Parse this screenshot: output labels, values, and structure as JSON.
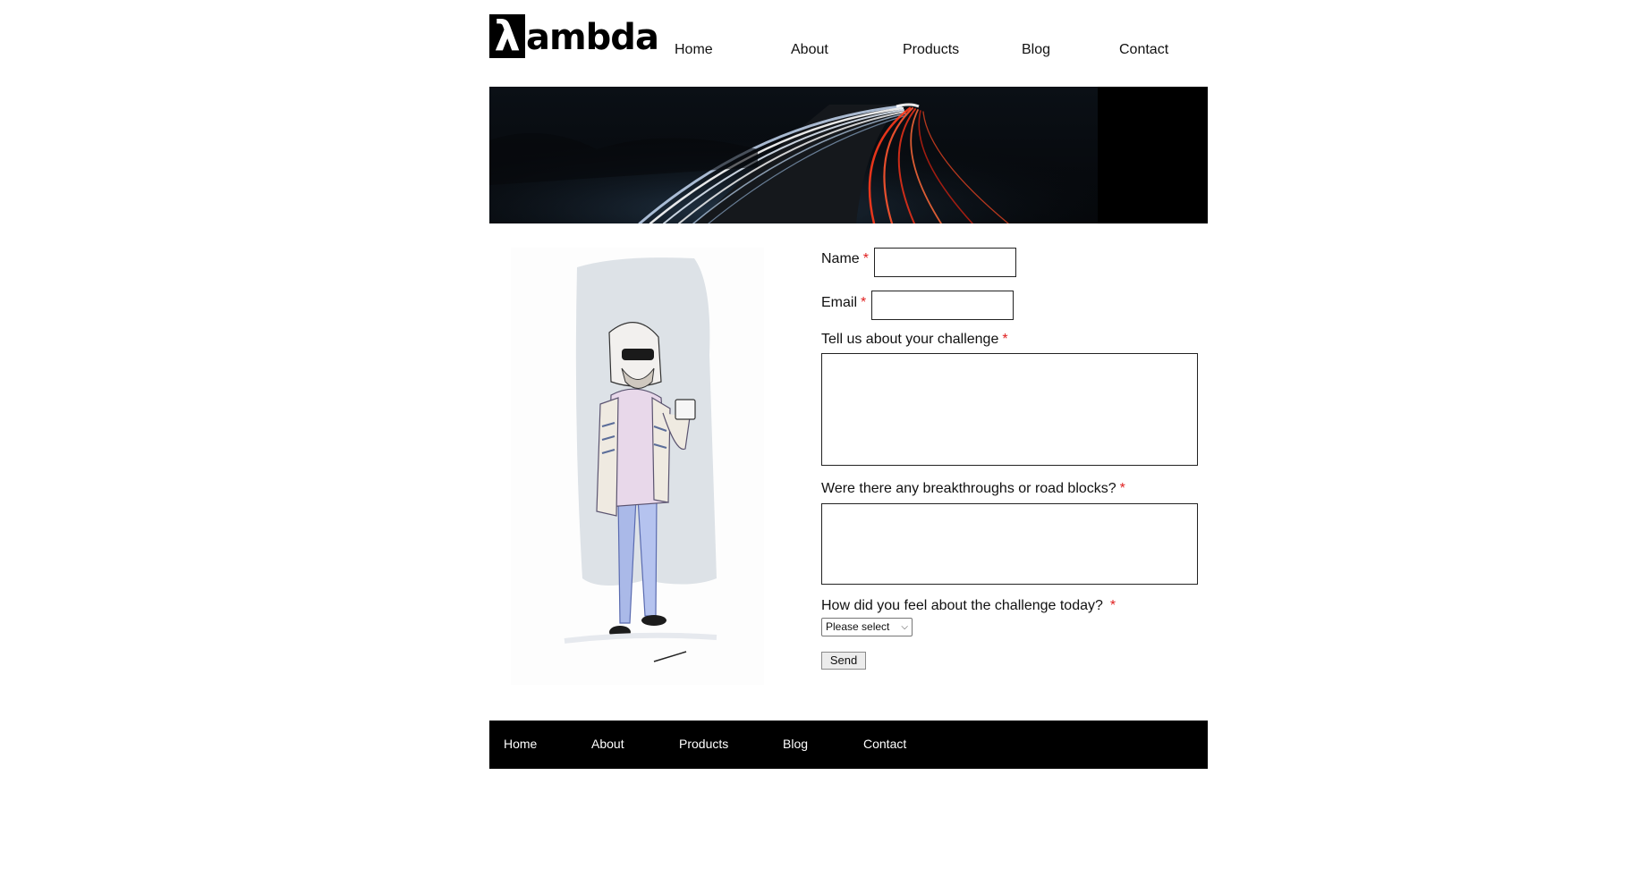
{
  "brand": {
    "logo_mark": "λ",
    "logo_text": "ambda"
  },
  "nav": {
    "items": [
      {
        "label": "Home"
      },
      {
        "label": "About"
      },
      {
        "label": "Products"
      },
      {
        "label": "Blog"
      },
      {
        "label": "Contact"
      }
    ]
  },
  "hero": {
    "icon": "highway-light-trails-image"
  },
  "illustration": {
    "icon": "dude-illustration"
  },
  "form": {
    "name_label": "Name",
    "email_label": "Email",
    "challenge_label": "Tell us about your challenge",
    "breakthrough_label": "Were there any breakthroughs or road blocks?",
    "feeling_label": "How did you feel about the challenge today?",
    "required_mark": "*",
    "name_value": "",
    "email_value": "",
    "challenge_value": "",
    "breakthrough_value": "",
    "feeling_selected": "Please select",
    "submit_label": "Send"
  },
  "footer": {
    "items": [
      {
        "label": "Home"
      },
      {
        "label": "About"
      },
      {
        "label": "Products"
      },
      {
        "label": "Blog"
      },
      {
        "label": "Contact"
      }
    ]
  },
  "colors": {
    "required": "#e02020",
    "footer_bg": "#000000"
  }
}
